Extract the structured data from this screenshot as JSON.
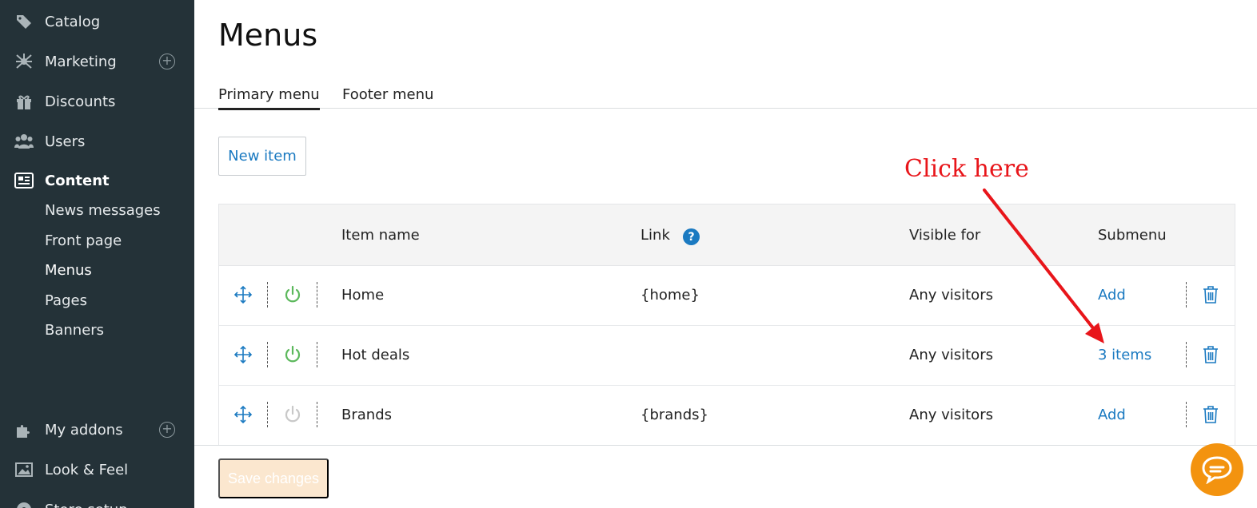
{
  "sidebar": {
    "items": [
      {
        "label": "Catalog",
        "icon": "tag-icon"
      },
      {
        "label": "Marketing",
        "icon": "network-icon"
      },
      {
        "label": "Discounts",
        "icon": "gift-icon"
      },
      {
        "label": "Users",
        "icon": "users-icon"
      },
      {
        "label": "Content",
        "icon": "newspaper-icon"
      }
    ],
    "content_subitems": [
      "News messages",
      "Front page",
      "Menus",
      "Pages",
      "Banners"
    ],
    "bottom_items": [
      {
        "label": "My addons",
        "icon": "puzzle-icon"
      },
      {
        "label": "Look & Feel",
        "icon": "image-icon"
      },
      {
        "label": "Store setup",
        "icon": "gear-icon"
      }
    ],
    "plus_symbol": "+"
  },
  "page": {
    "title": "Menus",
    "tabs": [
      "Primary menu",
      "Footer menu"
    ],
    "new_item_label": "New item",
    "save_label": "Save changes"
  },
  "table": {
    "headers": {
      "name": "Item name",
      "link": "Link",
      "visible": "Visible for",
      "submenu": "Submenu",
      "help": "?"
    },
    "rows": [
      {
        "name": "Home",
        "link": "{home}",
        "visible": "Any visitors",
        "submenu": "Add",
        "enabled": true
      },
      {
        "name": "Hot deals",
        "link": "",
        "visible": "Any visitors",
        "submenu": "3 items",
        "enabled": true
      },
      {
        "name": "Brands",
        "link": "{brands}",
        "visible": "Any visitors",
        "submenu": "Add",
        "enabled": false
      }
    ]
  },
  "annotation": {
    "text": "Click here",
    "color": "#e8151a"
  },
  "colors": {
    "accent": "#1b7ac1",
    "sidebar": "#243238",
    "power_on": "#5cb85c",
    "power_off": "#c8c8c8",
    "chat": "#f3930f"
  }
}
